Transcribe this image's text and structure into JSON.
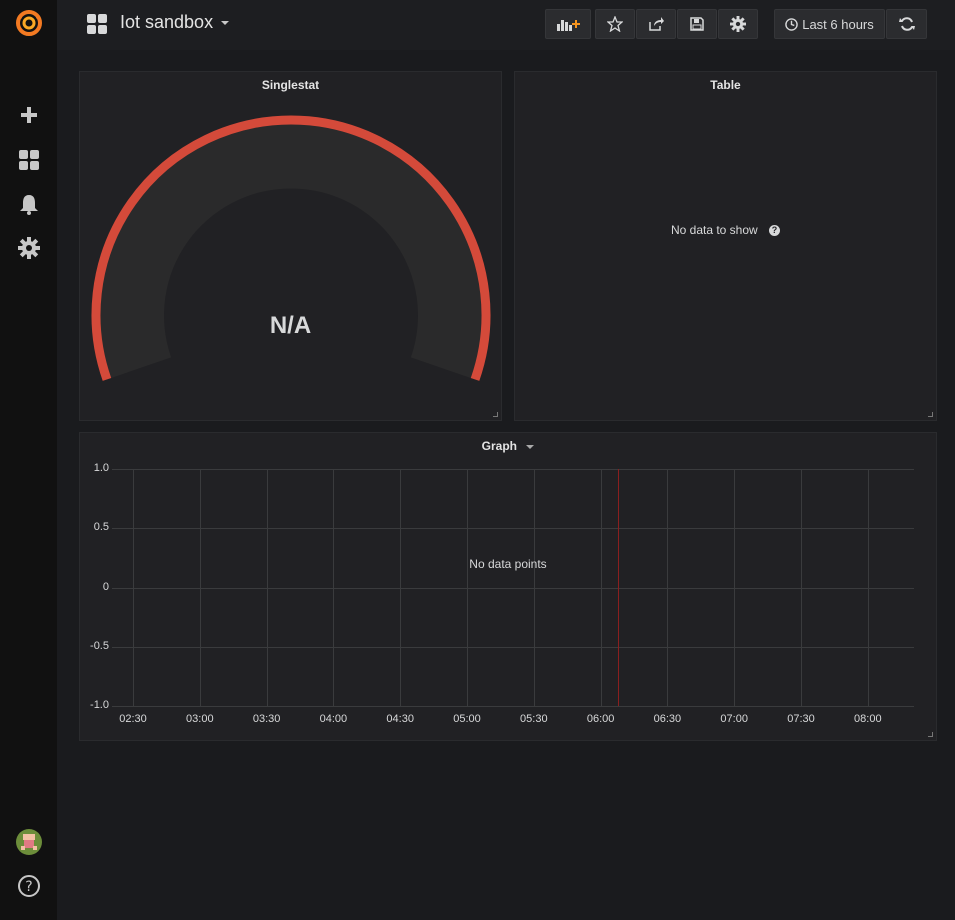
{
  "navbar": {
    "dashboard_title": "Iot sandbox",
    "time_range_label": "Last 6 hours",
    "buttons": [
      "add-panel",
      "star",
      "share",
      "save",
      "settings",
      "time-range",
      "refresh"
    ]
  },
  "sidebar": {
    "items": [
      {
        "icon": "grafana-logo-icon"
      },
      {
        "icon": "plus-icon"
      },
      {
        "icon": "dashboards-icon"
      },
      {
        "icon": "bell-icon"
      },
      {
        "icon": "gear-icon"
      },
      {
        "icon": "user-avatar"
      },
      {
        "icon": "help-icon"
      }
    ]
  },
  "panels": {
    "singlestat": {
      "title": "Singlestat",
      "value": "N/A",
      "gauge_color": "#d44a3a"
    },
    "table": {
      "title": "Table",
      "empty_message": "No data to show",
      "help_glyph": "?"
    },
    "graph": {
      "title": "Graph",
      "empty_message": "No data points",
      "now_marker_color": "#8a1f1f"
    }
  },
  "chart_data": {
    "type": "line",
    "title": "Graph",
    "series": [],
    "y_ticks": [
      "1.0",
      "0.5",
      "0",
      "-0.5",
      "-1.0"
    ],
    "x_ticks": [
      "02:30",
      "03:00",
      "03:30",
      "04:00",
      "04:30",
      "05:00",
      "05:30",
      "06:00",
      "06:30",
      "07:00",
      "07:30",
      "08:00"
    ],
    "ylim": [
      -1.0,
      1.0
    ],
    "grid": true,
    "now_marker": "06:08"
  }
}
